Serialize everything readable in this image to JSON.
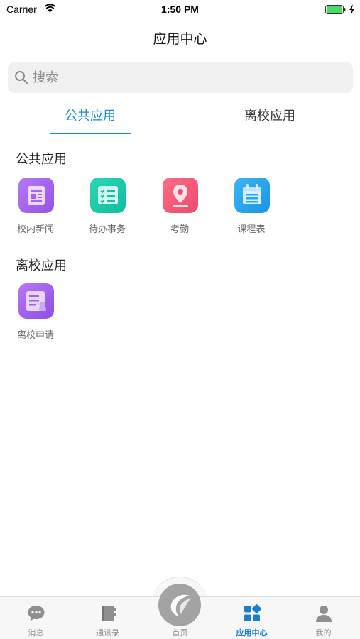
{
  "status_bar": {
    "carrier": "Carrier",
    "time": "1:50 PM"
  },
  "nav": {
    "title": "应用中心"
  },
  "search": {
    "placeholder": "搜索"
  },
  "tabs": [
    {
      "label": "公共应用",
      "active": true
    },
    {
      "label": "离校应用",
      "active": false
    }
  ],
  "sections": [
    {
      "title": "公共应用",
      "apps": [
        {
          "label": "校内新闻",
          "icon": "news-icon",
          "color": "#a666ee"
        },
        {
          "label": "待办事务",
          "icon": "checklist-icon",
          "color": "#19c9a8"
        },
        {
          "label": "考勤",
          "icon": "location-pin-icon",
          "color": "#f25a78"
        },
        {
          "label": "课程表",
          "icon": "calendar-icon",
          "color": "#2aa5ef"
        }
      ]
    },
    {
      "title": "离校应用",
      "apps": [
        {
          "label": "离校申请",
          "icon": "form-icon",
          "color": "#9d5fea"
        }
      ]
    }
  ],
  "tab_bar": {
    "items": [
      {
        "label": "消息",
        "icon": "chat-bubble-icon",
        "active": false
      },
      {
        "label": "通讯录",
        "icon": "contacts-book-icon",
        "active": false
      },
      {
        "label": "首页",
        "icon": "home-logo-icon",
        "active": false
      },
      {
        "label": "应用中心",
        "icon": "app-grid-icon",
        "active": true
      },
      {
        "label": "我的",
        "icon": "person-icon",
        "active": false
      }
    ]
  },
  "colors": {
    "accent": "#1a8ad6",
    "battery": "#4cd964"
  }
}
